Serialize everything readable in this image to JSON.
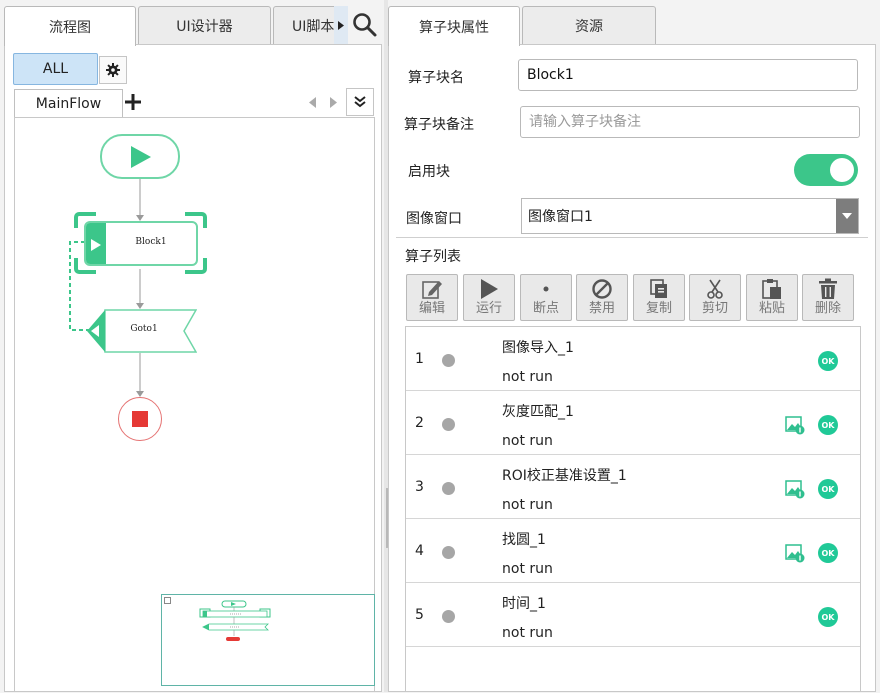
{
  "left_tabs": [
    {
      "label": "流程图",
      "active": true
    },
    {
      "label": "UI设计器",
      "active": false
    },
    {
      "label": "UI脚本",
      "active": false
    }
  ],
  "left_toolbar": {
    "all_label": "ALL",
    "flow_tab_label": "MainFlow"
  },
  "flow": {
    "block_label": "Block1",
    "goto_label": "Goto1"
  },
  "right_tabs": [
    {
      "label": "算子块属性",
      "active": true
    },
    {
      "label": "资源",
      "active": false
    }
  ],
  "props": {
    "name_label": "算子块名",
    "name_value": "Block1",
    "remark_label": "算子块备注",
    "remark_placeholder": "请输入算子块备注",
    "enable_label": "启用块",
    "enabled": true,
    "window_label": "图像窗口",
    "window_value": "图像窗口1",
    "list_label": "算子列表"
  },
  "toolbar": [
    {
      "label": "编辑",
      "icon": "edit-icon"
    },
    {
      "label": "运行",
      "icon": "play-icon"
    },
    {
      "label": "断点",
      "icon": "breakpoint-icon"
    },
    {
      "label": "禁用",
      "icon": "disable-icon"
    },
    {
      "label": "复制",
      "icon": "copy-icon"
    },
    {
      "label": "剪切",
      "icon": "cut-icon"
    },
    {
      "label": "粘贴",
      "icon": "paste-icon"
    },
    {
      "label": "删除",
      "icon": "delete-icon"
    }
  ],
  "operators": [
    {
      "index": "1",
      "name": "图像导入_1",
      "status": "not run",
      "has_image": false,
      "ok": "OK"
    },
    {
      "index": "2",
      "name": "灰度匹配_1",
      "status": "not run",
      "has_image": true,
      "ok": "OK"
    },
    {
      "index": "3",
      "name": "ROI校正基准设置_1",
      "status": "not run",
      "has_image": true,
      "ok": "OK"
    },
    {
      "index": "4",
      "name": "找圆_1",
      "status": "not run",
      "has_image": true,
      "ok": "OK"
    },
    {
      "index": "5",
      "name": "时间_1",
      "status": "not run",
      "has_image": false,
      "ok": "OK"
    }
  ],
  "colors": {
    "accent_green": "#3cc68a",
    "ok_green": "#20c997",
    "stop_red": "#e53935",
    "selected_blue": "#cde4f7"
  }
}
